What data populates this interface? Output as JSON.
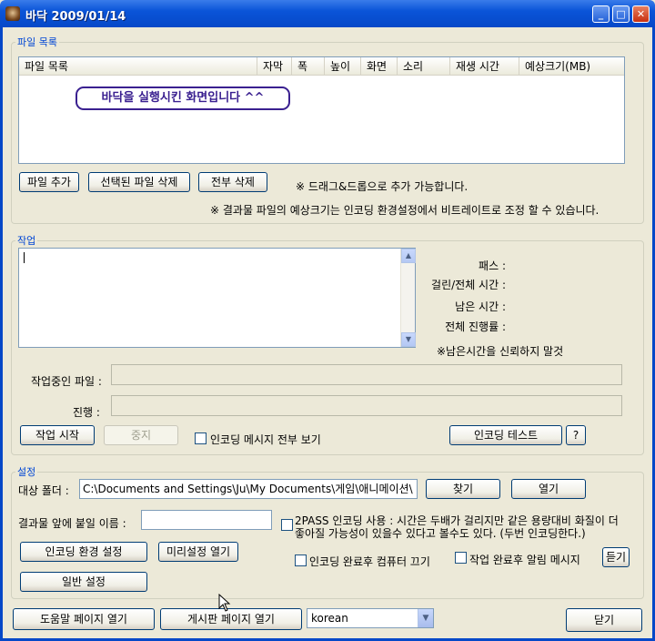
{
  "window": {
    "title": "바닥 2009/01/14",
    "minimize": "_",
    "maximize": "□",
    "close": "✕",
    "icon": "app-logo-icon"
  },
  "files": {
    "legend": "파일 목록",
    "columns": [
      "파일 목록",
      "자막",
      "폭",
      "높이",
      "화면",
      "소리",
      "재생 시간",
      "예상크기(MB)"
    ],
    "hint": "바닥을 실행시킨 화면입니다 ^^",
    "add_button": "파일 추가",
    "delete_selected_button": "선택된 파일 삭제",
    "delete_all_button": "전부 삭제",
    "dragdrop_note": "※ 드래그&드롭으로 추가 가능합니다.",
    "size_note": "※ 결과물 파일의 예상크기는 인코딩 환경설정에서 비트레이트로 조정 할 수 있습니다."
  },
  "task": {
    "legend": "작업",
    "path_label": "패스 :",
    "elapsed_label": "걸린/전체 시간 :",
    "remaining_label": "남은 시간 :",
    "total_progress_label": "전체 진행률 :",
    "remaining_note": "※남은시간을 신뢰하지 말것",
    "current_file_label": "작업중인 파일 :",
    "progress_label": "진행 :",
    "start_button": "작업 시작",
    "stop_button": "중지",
    "show_all_messages": "인코딩 메시지 전부 보기",
    "test_button": "인코딩 테스트",
    "help_button": "?"
  },
  "settings": {
    "legend": "설정",
    "target_folder_label": "대상 폴더 :",
    "target_folder_value": "C:\\Documents and Settings\\Ju\\My Documents\\게임\\애니메이션\\",
    "browse_button": "찾기",
    "open_button": "열기",
    "prefix_label": "결과물 앞에 붙일 이름 :",
    "prefix_value": "",
    "twopass_line1": "2PASS 인코딩 사용 : 시간은 두배가 걸리지만 같은 용량대비 화질이 더",
    "twopass_line2": "좋아질 가능성이 있을수 있다고 볼수도 있다. (두번 인코딩한다.)",
    "encoding_settings_button": "인코딩 환경 설정",
    "preset_button": "미리설정 열기",
    "shutdown_after": "인코딩 완료후 컴퓨터 끄기",
    "notify_after": "작업 완료후 알림 메시지",
    "listen_button": "듣기",
    "general_settings_button": "일반 설정"
  },
  "footer": {
    "help_page_button": "도움말 페이지 열기",
    "board_page_button": "게시판 페이지 열기",
    "language_selected": "korean",
    "close_button": "닫기"
  }
}
